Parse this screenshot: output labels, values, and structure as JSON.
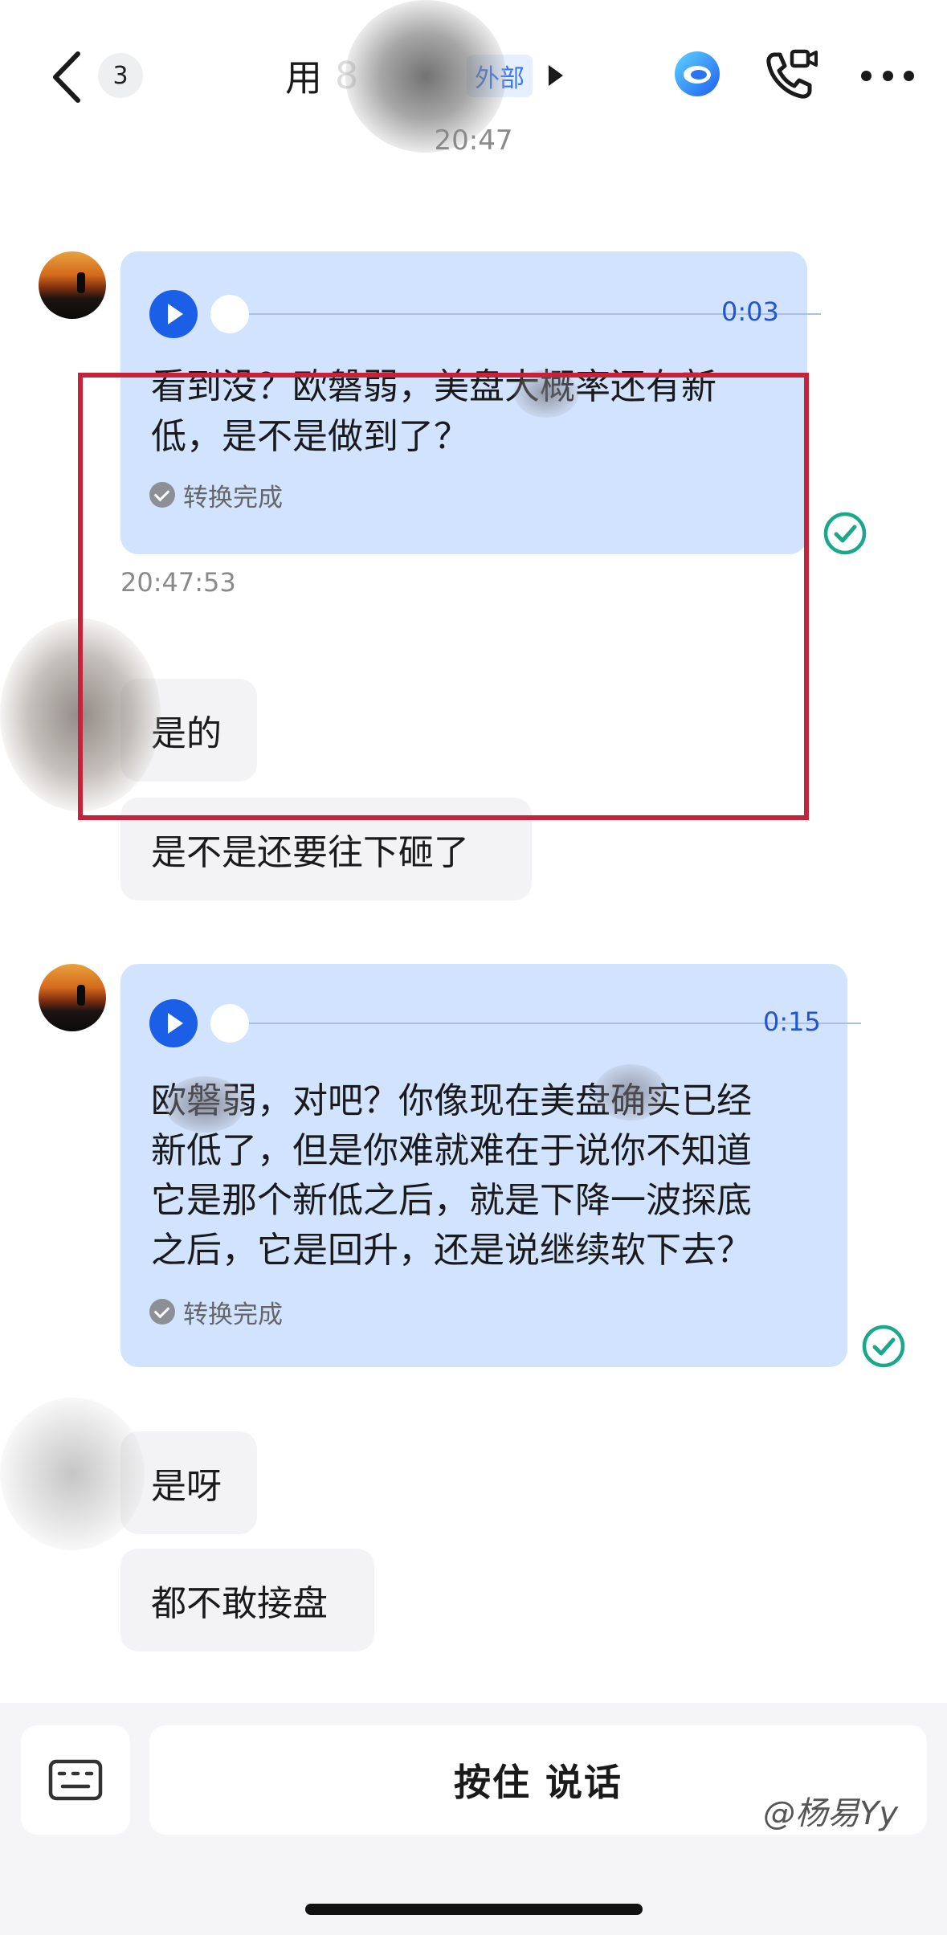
{
  "header": {
    "unread_count": "3",
    "title": "用",
    "title_suffix": "8",
    "tag": "外部",
    "time": "20:47"
  },
  "messages": {
    "voice1": {
      "duration": "0:03",
      "text_line1": "看到没？欧磐弱，美盘大概率还有新",
      "text_line2": "低，是不是做到了？",
      "status": "转换完成",
      "time": "20:47:53"
    },
    "text1": "是的",
    "text2": "是不是还要往下砸了",
    "voice2": {
      "duration": "0:15",
      "text_line1": "欧磐弱，对吧？你像现在美盘确实已经",
      "text_line2": "新低了，但是你难就难在于说你不知道",
      "text_line3": "它是那个新低之后，就是下降一波探底",
      "text_line4": "之后，它是回升，还是说继续软下去？",
      "status": "转换完成"
    },
    "text3": "是呀",
    "text4": "都不敢接盘"
  },
  "input": {
    "hold_to_talk": "按住 说话"
  },
  "watermark": "@杨易Yy",
  "colors": {
    "voice_bubble": "#d1e3fe",
    "play_button": "#1a5fe6",
    "read_check": "#1aa88c",
    "highlight_box": "#c4233a",
    "text_bubble": "#f3f3f5"
  },
  "icons": [
    "back-icon",
    "ai-assistant-icon",
    "video-call-icon",
    "more-icon",
    "play-icon",
    "check-icon",
    "keyboard-icon"
  ]
}
